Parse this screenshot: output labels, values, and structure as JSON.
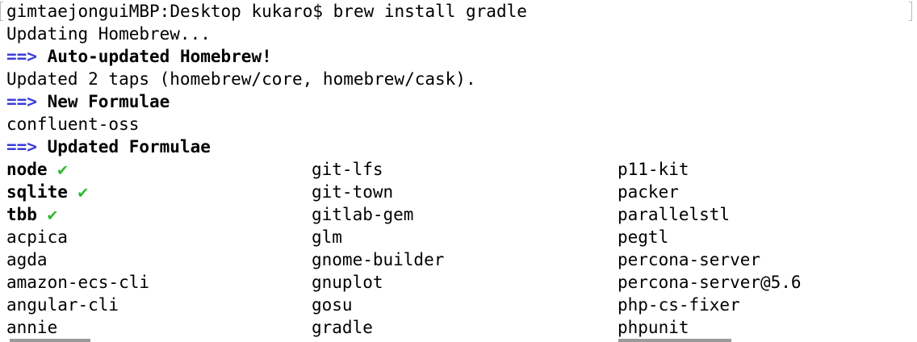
{
  "prompt": {
    "host": "gimtaejonguiMBP",
    "cwd": "Desktop",
    "user": "kukaro",
    "symbol": "$",
    "command": "brew install gradle"
  },
  "output": {
    "updating": "Updating Homebrew...",
    "arrow": "==>",
    "heading_auto_updated": "Auto-updated Homebrew!",
    "updated_taps": "Updated 2 taps (homebrew/core, homebrew/cask).",
    "heading_new_formulae": "New Formulae",
    "new_formulae": [
      "confluent-oss"
    ],
    "heading_updated_formulae": "Updated Formulae",
    "check_glyph": "✔"
  },
  "formulae": {
    "column1": [
      {
        "name": "node",
        "installed": true
      },
      {
        "name": "sqlite",
        "installed": true
      },
      {
        "name": "tbb",
        "installed": true
      },
      {
        "name": "acpica",
        "installed": false
      },
      {
        "name": "agda",
        "installed": false
      },
      {
        "name": "amazon-ecs-cli",
        "installed": false
      },
      {
        "name": "angular-cli",
        "installed": false
      },
      {
        "name": "annie",
        "installed": false
      }
    ],
    "column2": [
      "git-lfs",
      "git-town",
      "gitlab-gem",
      "glm",
      "gnome-builder",
      "gnuplot",
      "gosu",
      "gradle"
    ],
    "column3": [
      "p11-kit",
      "packer",
      "parallelstl",
      "pegtl",
      "percona-server",
      "percona-server@5.6",
      "php-cs-fixer",
      "phpunit"
    ]
  },
  "colors": {
    "arrow": "#3b3bd9",
    "check": "#2fb82f",
    "text": "#000000",
    "background": "#ffffff"
  }
}
